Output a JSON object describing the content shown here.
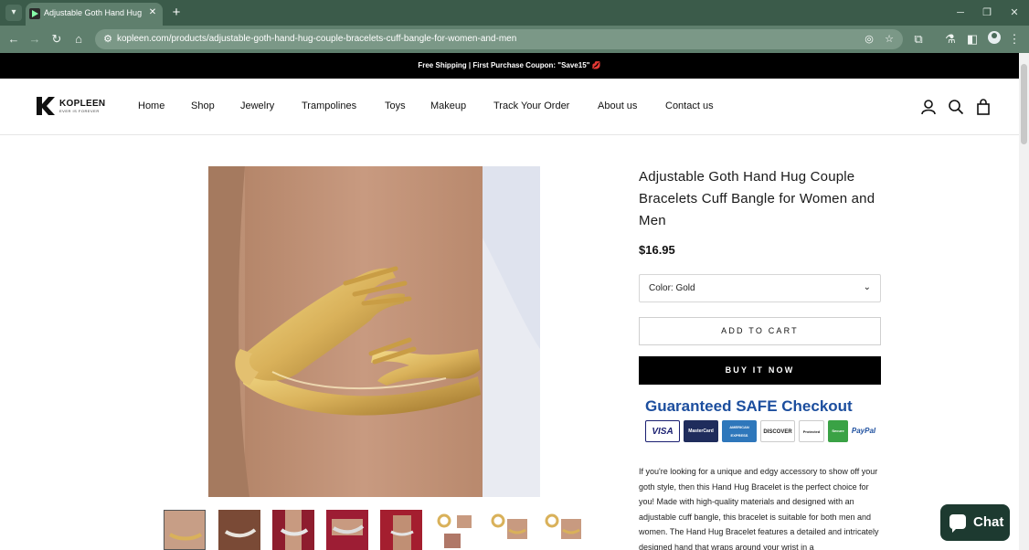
{
  "browser": {
    "tab_title": "Adjustable Goth Hand Hug Co...",
    "url": "kopleen.com/products/adjustable-goth-hand-hug-couple-bracelets-cuff-bangle-for-women-and-men",
    "new_tab_symbol": "+",
    "tab_close_symbol": "✕"
  },
  "announcement": "Free Shipping | First Purchase Coupon: \"Save15\" 💋",
  "header": {
    "logo_word": "KOPLEEN",
    "logo_tagline": "EVER IS FOREVER",
    "menu": [
      "Home",
      "Shop",
      "Jewelry",
      "Trampolines",
      "Toys",
      "Makeup",
      "Track Your Order",
      "About us",
      "Contact us"
    ]
  },
  "product": {
    "title": "Adjustable Goth Hand Hug Couple Bracelets Cuff Bangle for Women and Men",
    "price": "$16.95",
    "variant_label": "Color: Gold",
    "add_to_cart": "ADD TO CART",
    "buy_now": "BUY IT NOW",
    "thumbnail_count": 8,
    "description": "If you're looking for a unique and edgy accessory to show off your goth style, then this Hand Hug Bracelet is the perfect choice for you! Made with high-quality materials and designed with an adjustable cuff bangle, this bracelet is suitable for both men and women. The Hand Hug Bracelet features a detailed and intricately designed hand that wraps around your wrist in a"
  },
  "safe_checkout": {
    "title": "Guaranteed SAFE Checkout",
    "cards": [
      "VISA",
      "MasterCard",
      "AMERICAN EXPRESS",
      "DISCOVER",
      "Protected",
      "Secure",
      "PayPal"
    ]
  },
  "chat": {
    "label": "Chat"
  },
  "colors": {
    "chrome_dark": "#3b5b4a",
    "chrome_bar": "#5f7f6d",
    "announcement_bg": "#000000",
    "buy_button_bg": "#000000",
    "safe_title": "#1c4e9e",
    "chat_bg": "#1d3a30",
    "gold": "#d9b15a"
  }
}
